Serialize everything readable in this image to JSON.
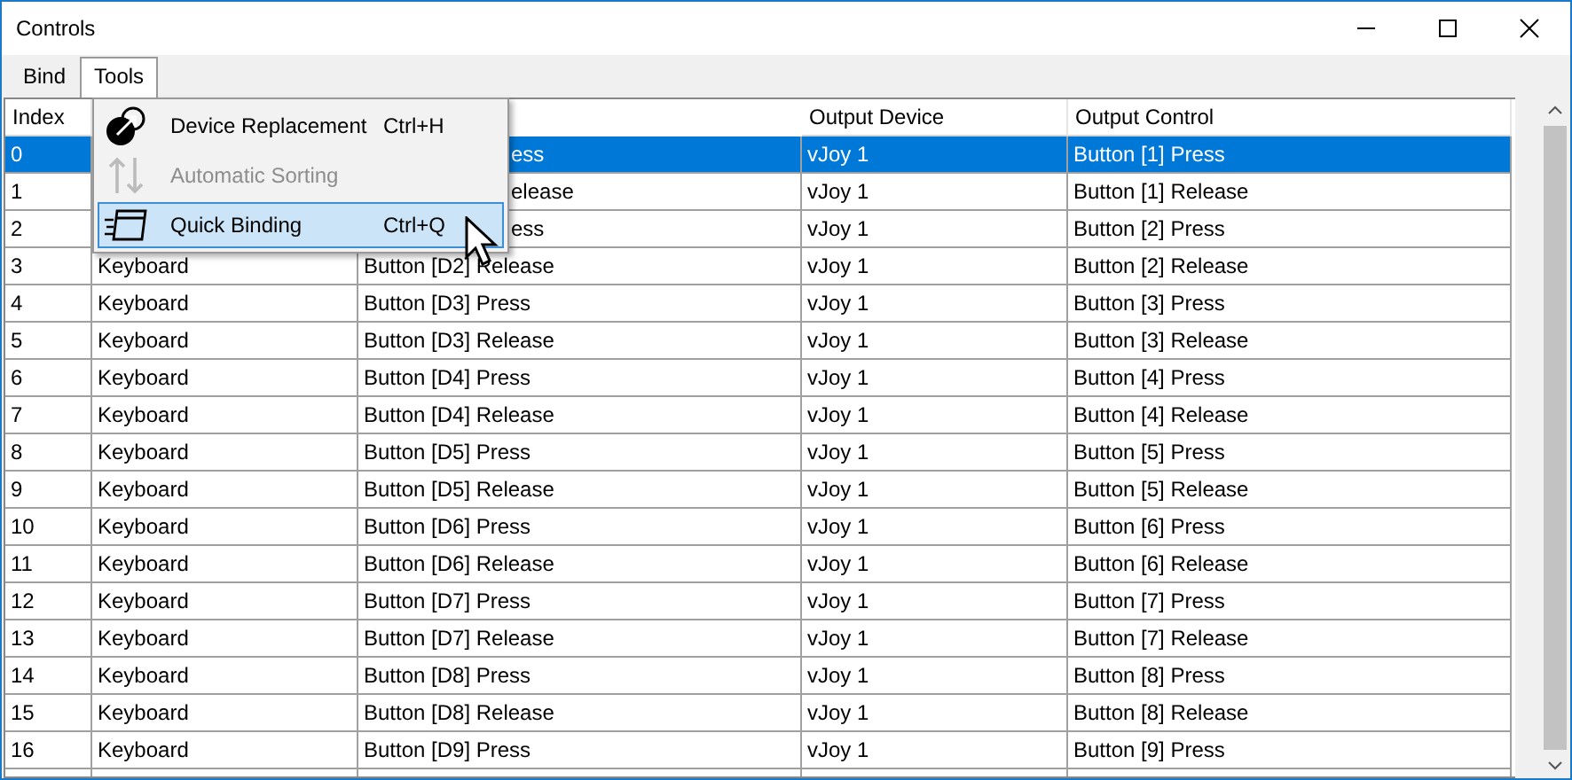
{
  "window": {
    "title": "Controls"
  },
  "menu_bar": [
    {
      "label": "Bind",
      "open": false
    },
    {
      "label": "Tools",
      "open": true
    }
  ],
  "dropdown": [
    {
      "label": "Device Replacement",
      "shortcut": "Ctrl+H",
      "disabled": false,
      "highlighted": false,
      "kind": "device"
    },
    {
      "label": "Automatic Sorting",
      "disabled": true,
      "highlighted": false,
      "kind": "sort"
    },
    {
      "label": "Quick Binding",
      "shortcut": "Ctrl+Q",
      "disabled": false,
      "highlighted": true,
      "kind": "quick"
    }
  ],
  "table": {
    "columns": [
      "Index",
      "",
      "",
      "Output Device",
      "Output Control"
    ],
    "rows": [
      {
        "selected": true,
        "under_menu": true,
        "cells": [
          "0",
          "",
          "ess",
          "vJoy 1",
          "Button [1] Press"
        ]
      },
      {
        "selected": false,
        "under_menu": true,
        "cells": [
          "1",
          "",
          "elease",
          "vJoy 1",
          "Button [1] Release"
        ]
      },
      {
        "selected": false,
        "under_menu": true,
        "cells": [
          "2",
          "",
          "ess",
          "vJoy 1",
          "Button [2] Press"
        ]
      },
      {
        "selected": false,
        "under_menu": false,
        "cells": [
          "3",
          "Keyboard",
          "Button [D2] Release",
          "vJoy 1",
          "Button [2] Release"
        ]
      },
      {
        "selected": false,
        "under_menu": false,
        "cells": [
          "4",
          "Keyboard",
          "Button [D3] Press",
          "vJoy 1",
          "Button [3] Press"
        ]
      },
      {
        "selected": false,
        "under_menu": false,
        "cells": [
          "5",
          "Keyboard",
          "Button [D3] Release",
          "vJoy 1",
          "Button [3] Release"
        ]
      },
      {
        "selected": false,
        "under_menu": false,
        "cells": [
          "6",
          "Keyboard",
          "Button [D4] Press",
          "vJoy 1",
          "Button [4] Press"
        ]
      },
      {
        "selected": false,
        "under_menu": false,
        "cells": [
          "7",
          "Keyboard",
          "Button [D4] Release",
          "vJoy 1",
          "Button [4] Release"
        ]
      },
      {
        "selected": false,
        "under_menu": false,
        "cells": [
          "8",
          "Keyboard",
          "Button [D5] Press",
          "vJoy 1",
          "Button [5] Press"
        ]
      },
      {
        "selected": false,
        "under_menu": false,
        "cells": [
          "9",
          "Keyboard",
          "Button [D5] Release",
          "vJoy 1",
          "Button [5] Release"
        ]
      },
      {
        "selected": false,
        "under_menu": false,
        "cells": [
          "10",
          "Keyboard",
          "Button [D6] Press",
          "vJoy 1",
          "Button [6] Press"
        ]
      },
      {
        "selected": false,
        "under_menu": false,
        "cells": [
          "11",
          "Keyboard",
          "Button [D6] Release",
          "vJoy 1",
          "Button [6] Release"
        ]
      },
      {
        "selected": false,
        "under_menu": false,
        "cells": [
          "12",
          "Keyboard",
          "Button [D7] Press",
          "vJoy 1",
          "Button [7] Press"
        ]
      },
      {
        "selected": false,
        "under_menu": false,
        "cells": [
          "13",
          "Keyboard",
          "Button [D7] Release",
          "vJoy 1",
          "Button [7] Release"
        ]
      },
      {
        "selected": false,
        "under_menu": false,
        "cells": [
          "14",
          "Keyboard",
          "Button [D8] Press",
          "vJoy 1",
          "Button [8] Press"
        ]
      },
      {
        "selected": false,
        "under_menu": false,
        "cells": [
          "15",
          "Keyboard",
          "Button [D8] Release",
          "vJoy 1",
          "Button [8] Release"
        ]
      },
      {
        "selected": false,
        "under_menu": false,
        "cells": [
          "16",
          "Keyboard",
          "Button [D9] Press",
          "vJoy 1",
          "Button [9] Press"
        ]
      }
    ]
  }
}
